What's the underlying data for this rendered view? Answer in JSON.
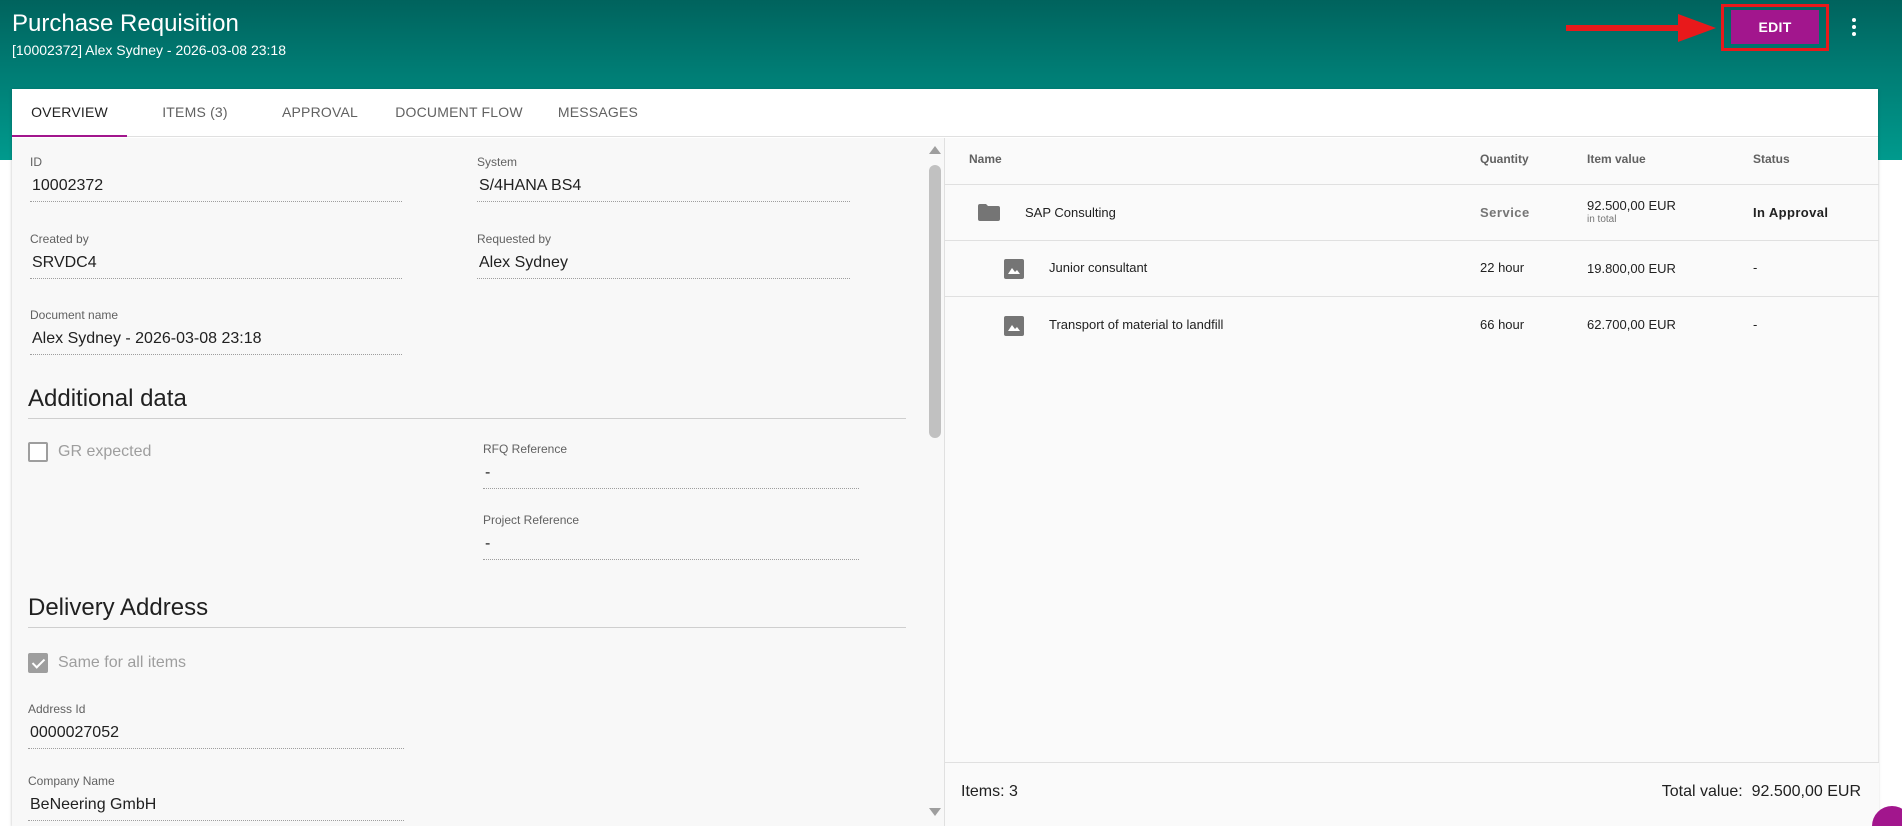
{
  "header": {
    "title": "Purchase Requisition",
    "subtitle": "[10002372] Alex Sydney - 2026-03-08 23:18",
    "edit_label": "EDIT"
  },
  "colors": {
    "header_dark": "#00635d",
    "header_light": "#009a8d",
    "accent": "#a2168d",
    "annotation": "#e8191b"
  },
  "tabs": [
    {
      "label": "OVERVIEW",
      "active": true
    },
    {
      "label": "ITEMS (3)",
      "active": false
    },
    {
      "label": "APPROVAL",
      "active": false
    },
    {
      "label": "DOCUMENT FLOW",
      "active": false
    },
    {
      "label": "MESSAGES",
      "active": false
    }
  ],
  "overview": {
    "id": {
      "label": "ID",
      "value": "10002372"
    },
    "system": {
      "label": "System",
      "value": "S/4HANA BS4"
    },
    "created_by": {
      "label": "Created by",
      "value": "SRVDC4"
    },
    "requested_by": {
      "label": "Requested by",
      "value": "Alex Sydney"
    },
    "document_name": {
      "label": "Document name",
      "value": "Alex Sydney - 2026-03-08 23:18"
    }
  },
  "additional_data": {
    "title": "Additional data",
    "gr_expected": {
      "label": "GR expected",
      "checked": false
    },
    "rfq_reference": {
      "label": "RFQ Reference",
      "value": "-"
    },
    "project_reference": {
      "label": "Project Reference",
      "value": "-"
    }
  },
  "delivery_address": {
    "title": "Delivery Address",
    "same_for_all": {
      "label": "Same for all items",
      "checked": true
    },
    "address_id": {
      "label": "Address Id",
      "value": "0000027052"
    },
    "company_name": {
      "label": "Company Name",
      "value": "BeNeering GmbH"
    }
  },
  "items_table": {
    "columns": [
      "Name",
      "Quantity",
      "Item value",
      "Status"
    ],
    "rows": [
      {
        "icon": "folder-icon",
        "name": "SAP Consulting",
        "quantity": "Service",
        "value": "92.500,00 EUR",
        "value_sub": "in total",
        "status": "In Approval"
      },
      {
        "icon": "image-icon",
        "name": "Junior consultant",
        "quantity": "22 hour",
        "value": "19.800,00 EUR",
        "value_sub": "",
        "status": "-"
      },
      {
        "icon": "image-icon",
        "name": "Transport of material to landfill",
        "quantity": "66 hour",
        "value": "62.700,00 EUR",
        "value_sub": "",
        "status": "-"
      }
    ],
    "footer_items": "Items: 3",
    "footer_total": "Total value:  92.500,00 EUR"
  }
}
